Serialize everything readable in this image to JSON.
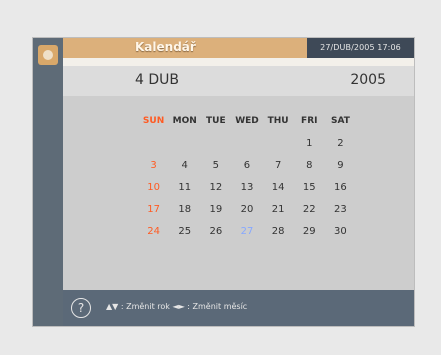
{
  "header": {
    "title": "Kalendář",
    "datetime": "27/DUB/2005  17:06",
    "month": "4 DUB",
    "year": "2005"
  },
  "calendar": {
    "weekdays": [
      "SUN",
      "MON",
      "TUE",
      "WED",
      "THU",
      "FRI",
      "SAT"
    ],
    "weeks": [
      [
        "",
        "",
        "",
        "",
        "",
        "1",
        "2"
      ],
      [
        "3",
        "4",
        "5",
        "6",
        "7",
        "8",
        "9"
      ],
      [
        "10",
        "11",
        "12",
        "13",
        "14",
        "15",
        "16"
      ],
      [
        "17",
        "18",
        "19",
        "20",
        "21",
        "22",
        "23"
      ],
      [
        "24",
        "25",
        "26",
        "27",
        "28",
        "29",
        "30"
      ]
    ],
    "today": "27"
  },
  "footer": {
    "help_symbol": "?",
    "hint": "▲▼ : Změnit rok   ◄► : Změnit měsíc"
  },
  "colors": {
    "accent": "#dcb07b",
    "sunday": "#ff5b23",
    "today": "#86a8ff",
    "footer": "#5b6978"
  }
}
